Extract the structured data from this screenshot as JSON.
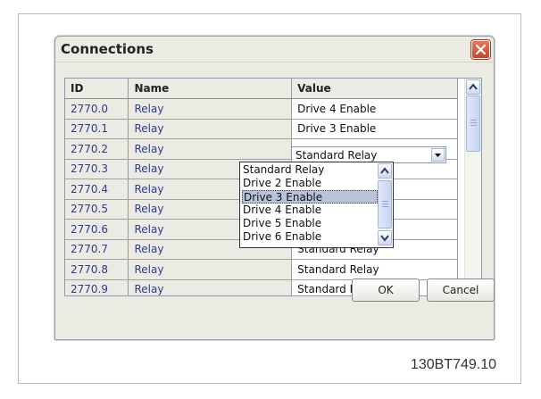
{
  "figure_id": "130BT749.10",
  "dialog": {
    "title": "Connections",
    "columns": [
      "ID",
      "Name",
      "Value"
    ],
    "rows": [
      {
        "id": "2770.0",
        "name": "Relay",
        "value": "Drive 4 Enable"
      },
      {
        "id": "2770.1",
        "name": "Relay",
        "value": "Drive 3 Enable"
      },
      {
        "id": "2770.2",
        "name": "Relay",
        "value": "Standard Relay"
      },
      {
        "id": "2770.3",
        "name": "Relay",
        "value": ""
      },
      {
        "id": "2770.4",
        "name": "Relay",
        "value": ""
      },
      {
        "id": "2770.5",
        "name": "Relay",
        "value": ""
      },
      {
        "id": "2770.6",
        "name": "Relay",
        "value": ""
      },
      {
        "id": "2770.7",
        "name": "Relay",
        "value": "Standard Relay"
      },
      {
        "id": "2770.8",
        "name": "Relay",
        "value": "Standard Relay"
      },
      {
        "id": "2770.9",
        "name": "Relay",
        "value": "Standard Relay"
      }
    ],
    "dropdown": {
      "selected_value": "Standard Relay",
      "options": [
        "Standard Relay",
        "Drive 2 Enable",
        "Drive 3 Enable",
        "Drive 4 Enable",
        "Drive 5 Enable",
        "Drive 6 Enable"
      ],
      "highlighted_option": "Drive 3 Enable"
    },
    "ok_label": "OK",
    "cancel_label": "Cancel"
  },
  "colors": {
    "title_close": "#d3573a",
    "link_text": "#2b3b8f",
    "selection": "#b8c2d8"
  },
  "icons": {
    "close": "close-icon",
    "scroll_up": "chevron-up-icon",
    "scroll_down": "chevron-down-icon",
    "dropdown": "triangle-down-icon"
  }
}
